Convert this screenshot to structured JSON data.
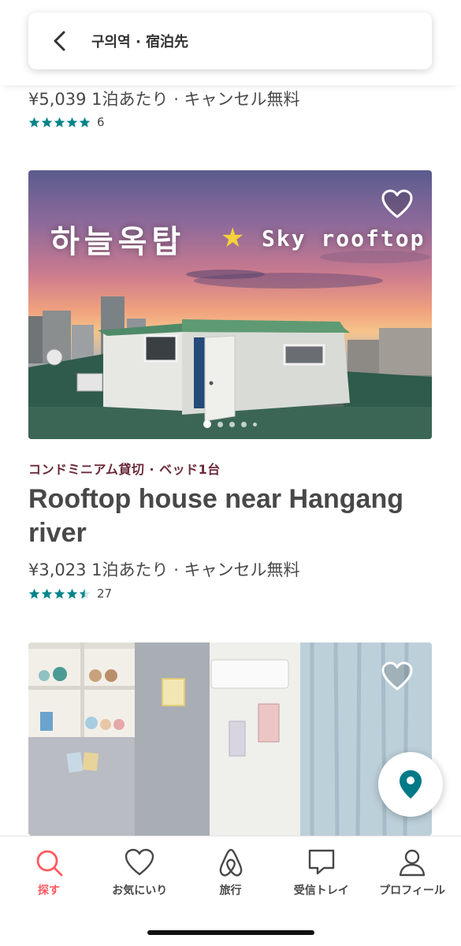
{
  "search": {
    "text": "구의역 · 宿泊先"
  },
  "listing_prev": {
    "price_line": "¥5,039 1泊あたり · キャンセル無料",
    "rating_count": "6",
    "stars": 5
  },
  "listing_1": {
    "photo_overlay_ko": "하늘옥탑",
    "photo_overlay_en": "Sky rooftop",
    "category": "コンドミニアム貸切 · ベッド1台",
    "title": "Rooftop house near Hangang river",
    "price_line": "¥3,023 1泊あたり · キャンセル無料",
    "rating_count": "27",
    "stars": 4.5,
    "photo_count": 5,
    "active_photo": 1
  },
  "nav": {
    "items": [
      {
        "label": "探す",
        "icon": "search-icon"
      },
      {
        "label": "お気にいり",
        "icon": "heart-icon"
      },
      {
        "label": "旅行",
        "icon": "airbnb-logo-icon"
      },
      {
        "label": "受信トレイ",
        "icon": "message-icon"
      },
      {
        "label": "プロフィール",
        "icon": "profile-icon"
      }
    ],
    "active": "探す"
  },
  "colors": {
    "accent": "#ff5a5f",
    "star": "#008489",
    "category": "#6b2a3a",
    "text": "#484848"
  }
}
